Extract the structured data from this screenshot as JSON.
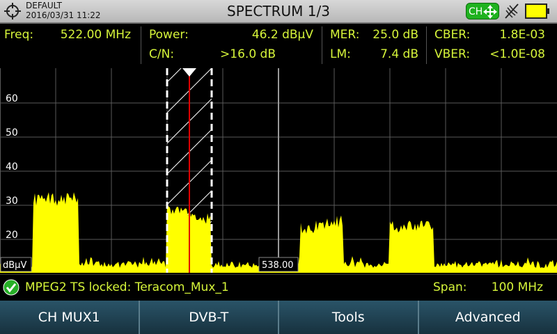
{
  "header": {
    "preset": "DEFAULT",
    "datetime": "2016/03/31 11:22",
    "title": "SPECTRUM 1/3",
    "ch_badge": "CH",
    "colors": {
      "bar_bg": "#c8c8c8",
      "ch_badge": "#1fb21f",
      "battery": "#ffff00"
    },
    "icons": [
      "crosshair-icon",
      "move-arrows-icon",
      "antenna-icon",
      "battery-icon"
    ]
  },
  "measurements": {
    "freq": {
      "label": "Freq:",
      "value": "522.00 MHz"
    },
    "power": {
      "label": "Power:",
      "value": "46.2 dBµV"
    },
    "cn": {
      "label": "C/N:",
      "value": ">16.0 dB"
    },
    "mer": {
      "label": "MER:",
      "value": "25.0 dB"
    },
    "lm": {
      "label": "LM:",
      "value": "7.4 dB"
    },
    "cber": {
      "label": "CBER:",
      "value": "1.8E-03"
    },
    "vber": {
      "label": "VBER:",
      "value": "<1.0E-08"
    },
    "color": "#d6f53a"
  },
  "spectrum": {
    "y_ticks": [
      "60",
      "50",
      "40",
      "30",
      "20"
    ],
    "unit": "dBµV",
    "center_label": "538.00",
    "trace_color": "#ffff00",
    "marker_color": "#e00000",
    "channel_freq_mhz": 522.0,
    "center_freq_mhz": 538.0,
    "span_mhz": 100
  },
  "status": {
    "lock_text": "MPEG2 TS locked: Teracom_Mux_1",
    "span_label": "Span:",
    "span_value": "100 MHz",
    "lock_icon": "check-circle-icon"
  },
  "softkeys": [
    {
      "label": "CH MUX1"
    },
    {
      "label": "DVB-T"
    },
    {
      "label": "Tools"
    },
    {
      "label": "Advanced"
    }
  ]
}
